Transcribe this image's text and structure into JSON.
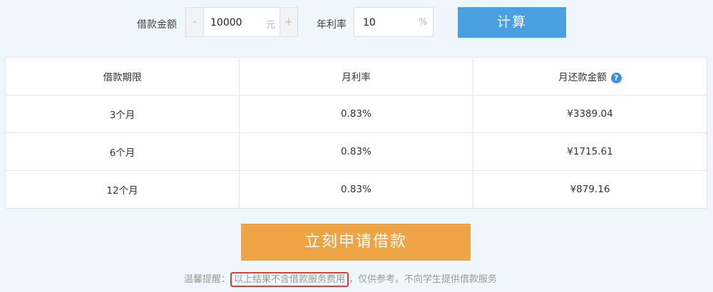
{
  "calculator": {
    "amount_label": "借款金额",
    "minus": "-",
    "amount_value": "10000",
    "amount_unit": "元",
    "plus": "+",
    "rate_label": "年利率",
    "rate_value": "10",
    "rate_unit": "%",
    "calc_button": "计算"
  },
  "table": {
    "headers": {
      "term": "借款期限",
      "monthly_rate": "月利率",
      "monthly_payment": "月还款金额"
    },
    "help_icon": "?",
    "rows": [
      {
        "term": "3个月",
        "monthly_rate": "0.83%",
        "monthly_payment": "¥3389.04"
      },
      {
        "term": "6个月",
        "monthly_rate": "0.83%",
        "monthly_payment": "¥1715.61"
      },
      {
        "term": "12个月",
        "monthly_rate": "0.83%",
        "monthly_payment": "¥879.16"
      }
    ]
  },
  "apply_button": "立刻申请借款",
  "notice": {
    "prefix": "温馨提醒：",
    "highlight": "以上结果不含借款服务费用",
    "suffix": "，仅供参考。不向学生提供借款服务"
  },
  "colors": {
    "background": "#eef7fb",
    "calc_button": "#4a9fe0",
    "apply_button": "#eea444",
    "help_icon": "#3a8ee6",
    "highlight_border": "#d9422e"
  }
}
